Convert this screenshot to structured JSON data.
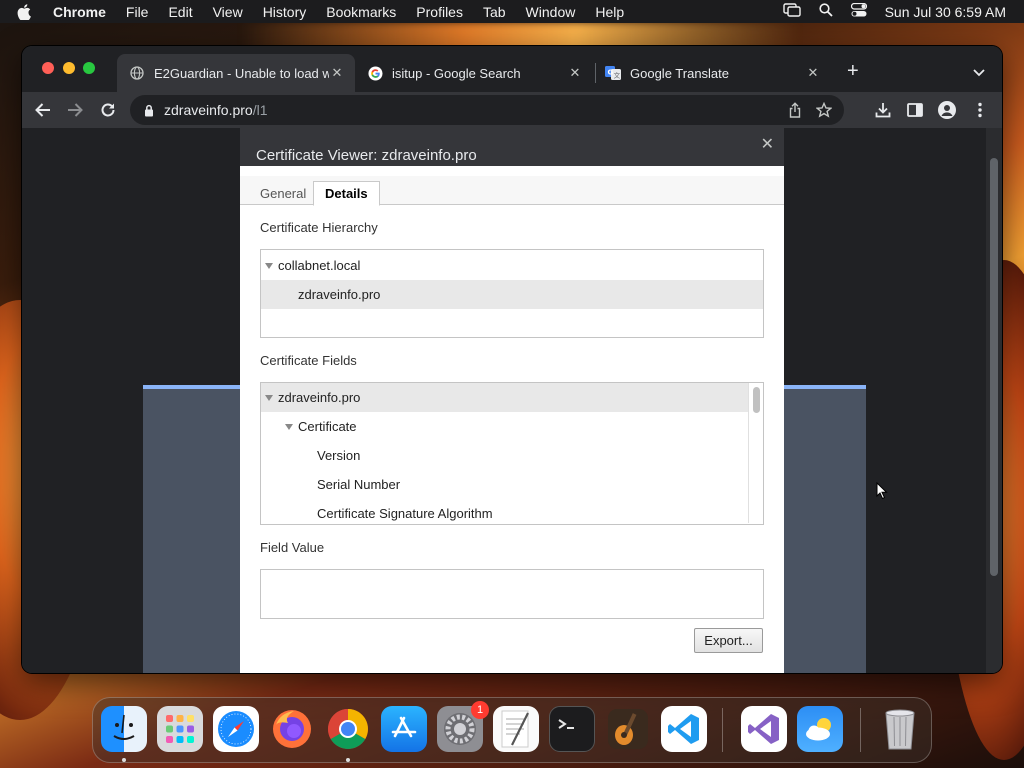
{
  "menubar": {
    "app_name": "Chrome",
    "items": [
      "File",
      "Edit",
      "View",
      "History",
      "Bookmarks",
      "Profiles",
      "Tab",
      "Window",
      "Help"
    ],
    "clock": "Sun Jul 30  6:59 AM"
  },
  "browser": {
    "tabs": [
      {
        "title": "E2Guardian - Unable to load w",
        "icon": "globe-icon",
        "active": true
      },
      {
        "title": "isitup - Google Search",
        "icon": "google-icon",
        "active": false
      },
      {
        "title": "Google Translate",
        "icon": "google-translate-icon",
        "active": false
      }
    ],
    "new_tab_label": "+",
    "url_host": "zdraveinfo.pro",
    "url_path": "/l1"
  },
  "dialog": {
    "title": "Certificate Viewer: zdraveinfo.pro",
    "close_label": "✕",
    "tabs": [
      "General",
      "Details"
    ],
    "active_tab": "Details",
    "hierarchy_label": "Certificate Hierarchy",
    "hierarchy": [
      "collabnet.local",
      "zdraveinfo.pro"
    ],
    "fields_label": "Certificate Fields",
    "fields": [
      "zdraveinfo.pro",
      "Certificate",
      "Version",
      "Serial Number",
      "Certificate Signature Algorithm"
    ],
    "field_value_label": "Field Value",
    "field_value": "",
    "export_label": "Export..."
  },
  "dock": {
    "apps": [
      "Finder",
      "Launchpad",
      "Safari",
      "Firefox",
      "Chrome",
      "App Store",
      "System Settings",
      "TextEdit",
      "Terminal",
      "GarageBand",
      "Visual Studio Code",
      "Visual Studio",
      "Weather",
      "Trash"
    ],
    "system_settings_badge": "1"
  },
  "colors": {
    "accent": "#8ab4f8",
    "tab_bg": "#202124",
    "toolbar_bg": "#35363a"
  }
}
